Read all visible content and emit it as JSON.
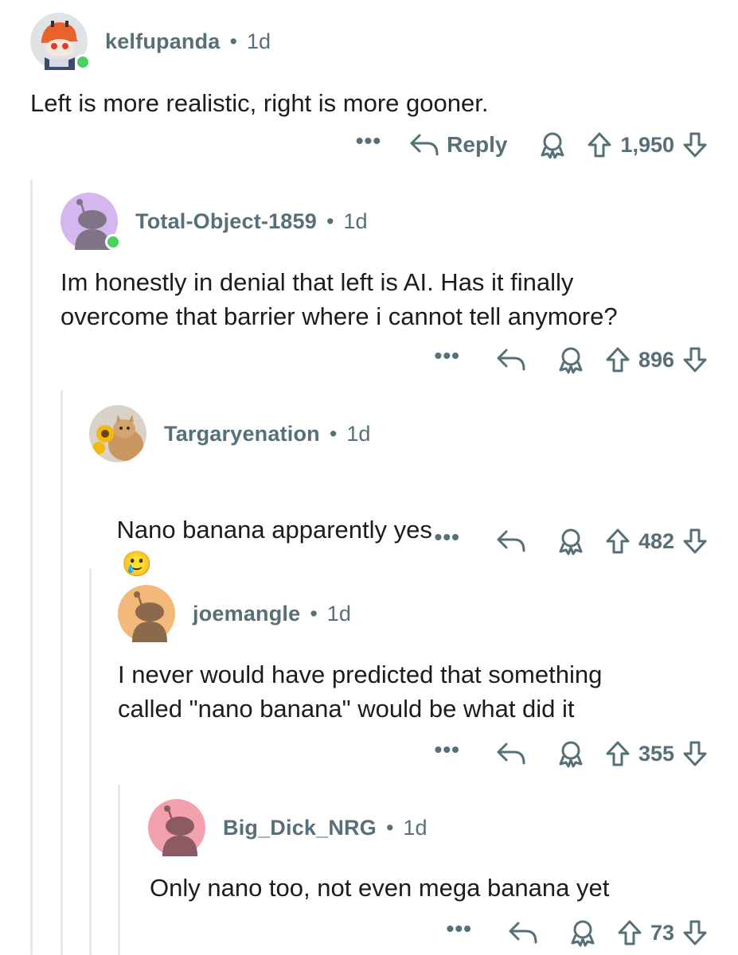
{
  "comments": [
    {
      "username": "kelfupanda",
      "separator": "•",
      "age": "1d",
      "body": "Left is more realistic, right is more gooner.",
      "reply_label": "Reply",
      "score": "1,950",
      "more": "•••",
      "avatar_color": "#dfe3e6",
      "online": true
    },
    {
      "username": "Total-Object-1859",
      "separator": "•",
      "age": "1d",
      "body": "Im honestly in denial that left is AI. Has it finally\novercome that barrier where i cannot tell anymore?",
      "score": "896",
      "more": "•••",
      "avatar_color": "#d5b7ef",
      "online": true
    },
    {
      "username": "Targaryenation",
      "separator": "•",
      "age": "1d",
      "body": "Nano banana apparently yes",
      "emoji": "🥲",
      "score": "482",
      "more": "•••"
    },
    {
      "username": "joemangle",
      "separator": "•",
      "age": "1d",
      "body": "I never would have predicted that something\ncalled \"nano banana\" would be what did it",
      "score": "355",
      "more": "•••",
      "avatar_color": "#f3b97a"
    },
    {
      "username": "Big_Dick_NRG",
      "separator": "•",
      "age": "1d",
      "body": "Only nano too, not even mega banana yet",
      "score": "73",
      "more": "•••",
      "avatar_color": "#f2a1ad"
    }
  ],
  "icons": {
    "reply": "reply-arrow-icon",
    "award": "award-icon",
    "upvote": "upvote-arrow-icon",
    "downvote": "downvote-arrow-icon",
    "more": "more-dots-icon"
  },
  "colors": {
    "meta_text": "#576f76",
    "body_text": "#1c1c1c",
    "thread_line": "#e7e8ea",
    "online_dot": "#46d160"
  }
}
